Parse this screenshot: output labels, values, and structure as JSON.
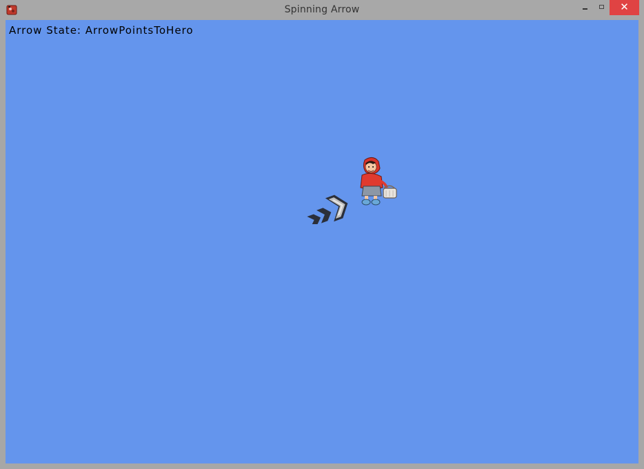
{
  "window": {
    "title": "Spinning Arrow",
    "close_label": "✕",
    "app_icon": "game-app-icon"
  },
  "game": {
    "background_color": "#6495ed",
    "status_text": "Arrow State: ArrowPointsToHero",
    "sprites": {
      "arrow": "chevron-arrow-sprite",
      "hero": "hero-character-sprite"
    }
  }
}
